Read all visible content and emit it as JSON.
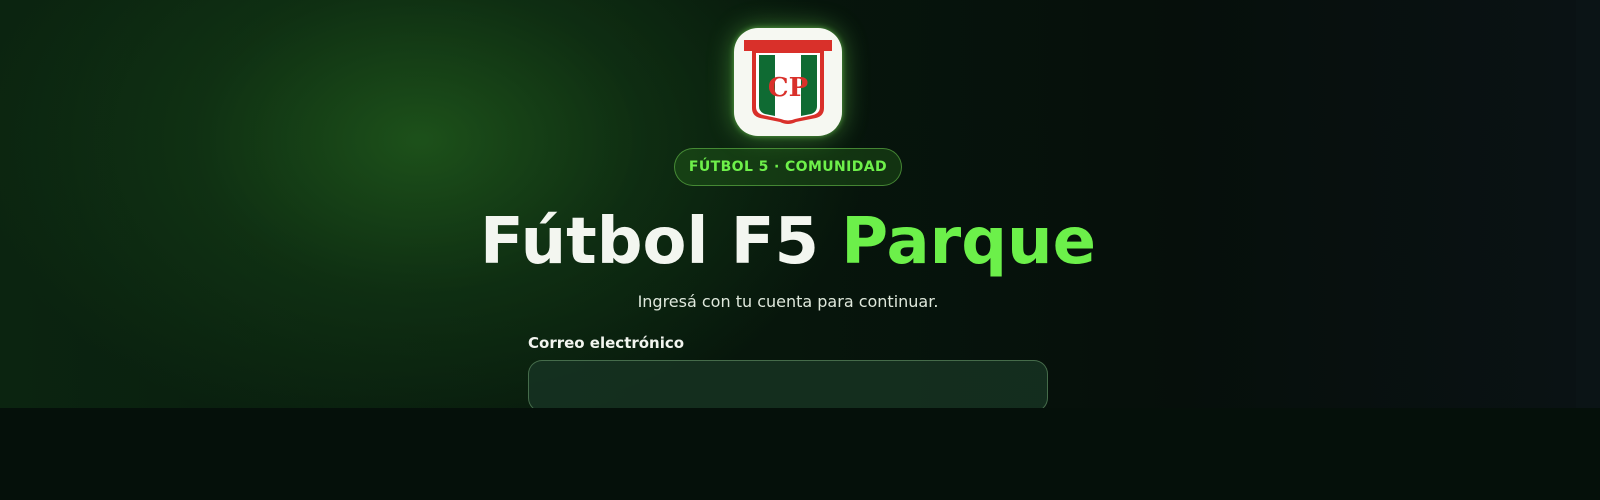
{
  "logo": {
    "monogram": "CP",
    "icon": "club-shield-icon",
    "colors": {
      "green": "#0f6b33",
      "red": "#d9302a",
      "white": "#ffffff"
    }
  },
  "badge": {
    "label": "FÚTBOL 5 · COMUNIDAD"
  },
  "hero": {
    "title_main": "Fútbol F5",
    "title_accent": "Parque",
    "subtitle": "Ingresá con tu cuenta para continuar."
  },
  "login": {
    "email_label": "Correo electrónico",
    "email_value": ""
  },
  "colors": {
    "accent": "#6cf04a",
    "background": "#06140b"
  }
}
